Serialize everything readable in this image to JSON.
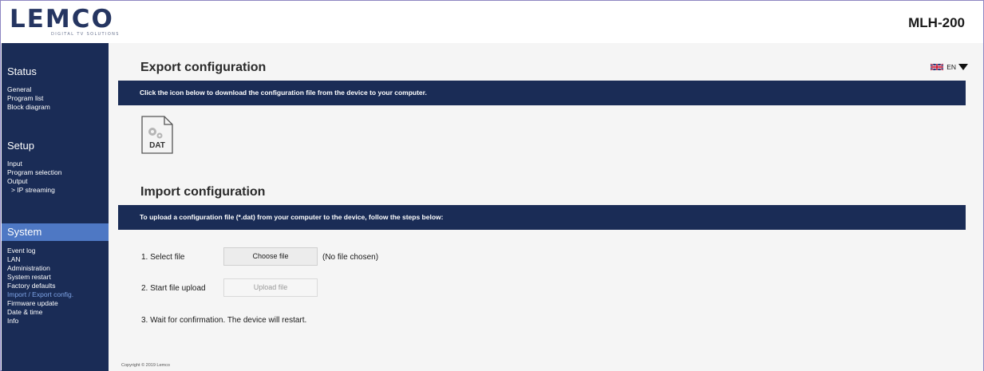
{
  "header": {
    "logo_text": "LEMCO",
    "logo_subtitle": "DIGITAL TV SOLUTIONS",
    "model": "MLH-200"
  },
  "sidebar": {
    "status": {
      "heading": "Status",
      "items": [
        "General",
        "Program list",
        "Block diagram"
      ]
    },
    "setup": {
      "heading": "Setup",
      "items": [
        "Input",
        "Program selection",
        "Output"
      ],
      "subitem": "> IP streaming"
    },
    "system": {
      "heading": "System",
      "items": [
        "Event log",
        "LAN",
        "Administration",
        "System restart",
        "Factory defaults",
        "Import / Export config.",
        "Firmware update",
        "Date & time",
        "Info"
      ],
      "current_index": 5
    }
  },
  "language": {
    "selected": "EN",
    "flag_icon": "uk-flag-icon"
  },
  "export": {
    "title": "Export configuration",
    "instruction": "Click the icon below to download the configuration file from the device to your computer.",
    "icon_label": "DAT"
  },
  "import": {
    "title": "Import configuration",
    "instruction": "To upload a configuration file (*.dat) from your computer to the device, follow the steps below:",
    "step1_label": "1. Select file",
    "choose_button": "Choose file",
    "file_status": "(No file chosen)",
    "step2_label": "2. Start file upload",
    "upload_button": "Upload file",
    "step3_label": "3. Wait for confirmation. The device will restart."
  },
  "footer": {
    "copyright": "Copyright © 2019 Lemco"
  },
  "colors": {
    "navy": "#1a2c56",
    "active_section": "#4e78c4",
    "current_item": "#7ea3e5"
  }
}
